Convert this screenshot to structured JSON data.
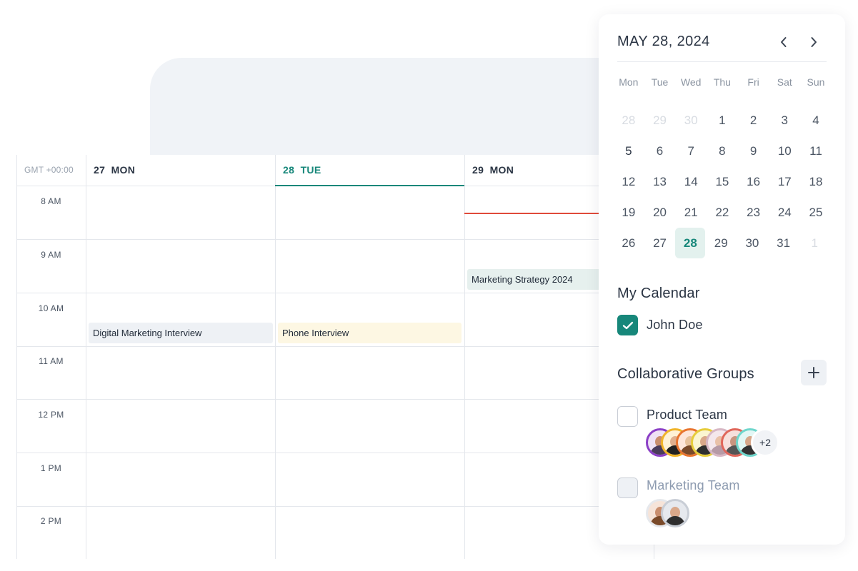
{
  "calendar": {
    "timezone": "GMT +00:00",
    "days": [
      {
        "num": "27",
        "name": "MON"
      },
      {
        "num": "28",
        "name": "TUE"
      },
      {
        "num": "29",
        "name": "MON"
      }
    ],
    "times": [
      "8 AM",
      "9 AM",
      "10 AM",
      "11 AM",
      "12 PM",
      "1 PM",
      "2 PM"
    ],
    "events": {
      "digital": "Digital Marketing Interview",
      "phone": "Phone Interview",
      "strategy": "Marketing Strategy 2024"
    },
    "colors": {
      "accent": "#17877a",
      "now_line": "#e04a3a"
    }
  },
  "panel": {
    "month_title": "MAY 28, 2024",
    "weekdays": [
      "Mon",
      "Tue",
      "Wed",
      "Thu",
      "Fri",
      "Sat",
      "Sun"
    ],
    "weeks": [
      [
        "28",
        "29",
        "30",
        "1",
        "2",
        "3",
        "4"
      ],
      [
        "5",
        "6",
        "7",
        "8",
        "9",
        "10",
        "11"
      ],
      [
        "12",
        "13",
        "14",
        "15",
        "16",
        "17",
        "18"
      ],
      [
        "19",
        "20",
        "21",
        "22",
        "23",
        "24",
        "25"
      ],
      [
        "26",
        "27",
        "28",
        "29",
        "30",
        "31",
        "1"
      ]
    ],
    "selected_date": "28",
    "my_calendar": {
      "title": "My Calendar",
      "user": "John Doe",
      "checked": true
    },
    "collab": {
      "title": "Collaborative Groups",
      "groups": [
        {
          "name": "Product Team",
          "checked": false,
          "extra": "+2"
        },
        {
          "name": "Marketing Team",
          "checked": false
        }
      ]
    }
  }
}
